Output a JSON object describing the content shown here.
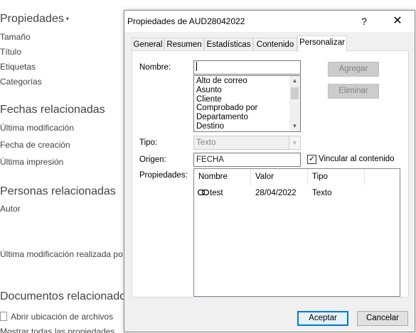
{
  "background": {
    "properties_heading": "Propiedades",
    "properties_items": [
      "Tamaño",
      "Título",
      "Etiquetas",
      "Categorías"
    ],
    "dates_heading": "Fechas relacionadas",
    "dates_items": [
      "Última modificación",
      "Fecha de creación",
      "Última impresión"
    ],
    "people_heading": "Personas relacionadas",
    "author_label": "Autor",
    "last_modified_by": "Última modificación realizada po",
    "docs_heading": "Documentos relacionados",
    "open_location": "Abrir ubicación de archivos",
    "cut_text": "Mostrar todas las propiedades"
  },
  "dialog": {
    "title": "Propiedades de AUD28042022",
    "help_glyph": "?",
    "close_glyph": "✕",
    "tabs": [
      "General",
      "Resumen",
      "Estadísticas",
      "Contenido",
      "Personalizar"
    ],
    "active_tab": "Personalizar",
    "name_label": "Nombre:",
    "name_value": "",
    "name_options": [
      "Alto de correo",
      "Asunto",
      "Cliente",
      "Comprobado por",
      "Departamento",
      "Destino"
    ],
    "add_button": "Agregar",
    "delete_button": "Eliminar",
    "type_label": "Tipo:",
    "type_value": "Texto",
    "origin_label": "Origen:",
    "origin_value": "FECHA",
    "link_checkbox_label": "Vincular al contenido",
    "link_checked": true,
    "properties_label": "Propiedades:",
    "list_columns": [
      "Nombre",
      "Valor",
      "Tipo"
    ],
    "list_rows": [
      {
        "name": "test",
        "value": "28/04/2022",
        "type": "Texto"
      }
    ],
    "ok_button": "Aceptar",
    "cancel_button": "Cancelar"
  }
}
